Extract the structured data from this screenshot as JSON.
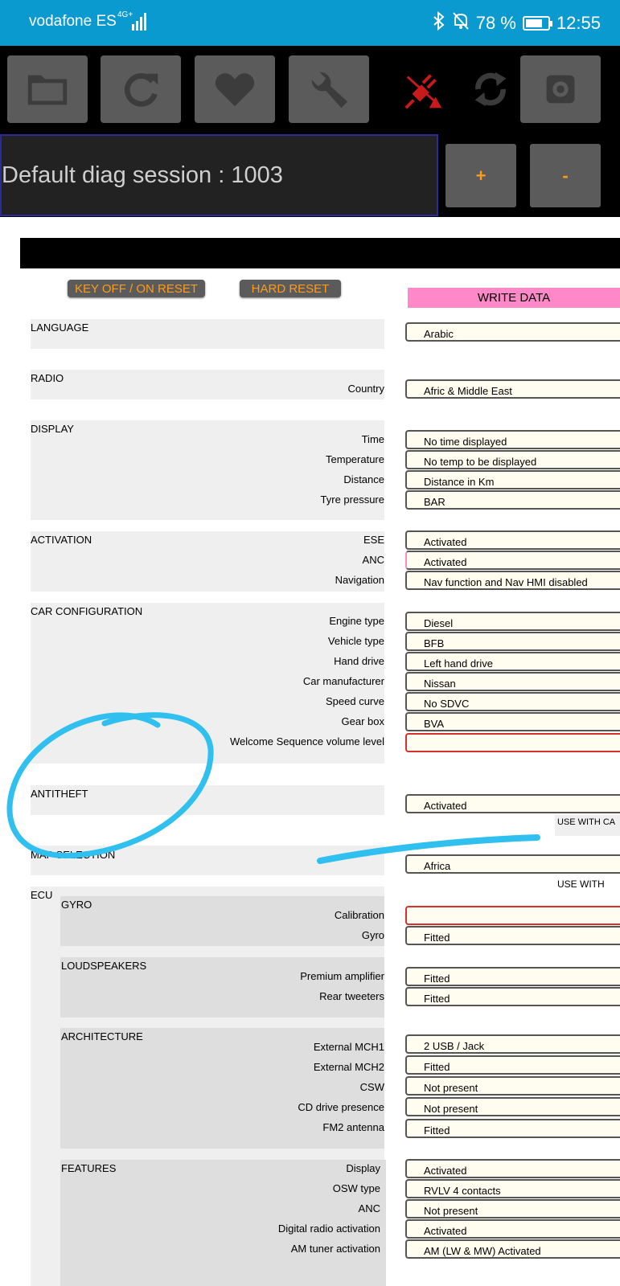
{
  "status_bar": {
    "carrier": "vodafone ES",
    "network": "4G+",
    "battery": "78 %",
    "battery_level": 0.78,
    "time": "12:55"
  },
  "toolbar": {
    "icons": [
      "folder-icon",
      "refresh-icon",
      "heart-icon",
      "wrench-icon",
      "disconnected-plug-icon",
      "sync-icon",
      "gear-icon"
    ],
    "session": "Default diag session : 1003",
    "plus_label": "+",
    "minus_label": "-"
  },
  "actions": {
    "key_reset": "KEY OFF / ON RESET",
    "hard_reset": "HARD RESET",
    "write_data": "WRITE DATA"
  },
  "sections": {
    "language": {
      "title": "LANGUAGE",
      "value": "Arabic"
    },
    "radio": {
      "title": "RADIO",
      "country_label": "Country",
      "country_value": "Afric & Middle East"
    },
    "display": {
      "title": "DISPLAY",
      "rows": [
        {
          "label": "Time",
          "value": "No time displayed"
        },
        {
          "label": "Temperature",
          "value": "No temp to be displayed"
        },
        {
          "label": "Distance",
          "value": "Distance in Km"
        },
        {
          "label": "Tyre pressure",
          "value": "BAR"
        }
      ]
    },
    "activation": {
      "title": "ACTIVATION",
      "rows": [
        {
          "label": "ESE",
          "value": "Activated"
        },
        {
          "label": "ANC",
          "value": "Activated"
        },
        {
          "label": "Navigation",
          "value": "Nav function and Nav HMI disabled"
        }
      ]
    },
    "car_configuration": {
      "title": "CAR CONFIGURATION",
      "rows": [
        {
          "label": "Engine type",
          "value": "Diesel"
        },
        {
          "label": "Vehicle type",
          "value": "BFB"
        },
        {
          "label": "Hand drive",
          "value": "Left hand drive"
        },
        {
          "label": "Car manufacturer",
          "value": "Nissan"
        },
        {
          "label": "Speed curve",
          "value": "No SDVC"
        },
        {
          "label": "Gear box",
          "value": "BVA"
        },
        {
          "label": "Welcome Sequence volume level",
          "value": ""
        }
      ]
    },
    "antitheft": {
      "title": "ANTITHEFT",
      "value": "Activated",
      "note": "USE WITH CA"
    },
    "map_selection": {
      "title": "MAP SELECTION",
      "value": "Africa",
      "note": "USE WITH"
    },
    "ecu": {
      "title": "ECU",
      "gyro": {
        "title": "GYRO",
        "rows": [
          {
            "label": "Calibration",
            "value": ""
          },
          {
            "label": "Gyro",
            "value": "Fitted"
          }
        ]
      },
      "loudspeakers": {
        "title": "LOUDSPEAKERS",
        "rows": [
          {
            "label": "Premium amplifier",
            "value": "Fitted"
          },
          {
            "label": "Rear tweeters",
            "value": "Fitted"
          }
        ]
      },
      "architecture": {
        "title": "ARCHITECTURE",
        "rows": [
          {
            "label": "External MCH1",
            "value": "2 USB / Jack"
          },
          {
            "label": "External MCH2",
            "value": "Fitted"
          },
          {
            "label": "CSW",
            "value": "Not present"
          },
          {
            "label": "CD drive presence",
            "value": "Not present"
          },
          {
            "label": "FM2 antenna",
            "value": "Fitted"
          }
        ]
      },
      "features": {
        "title": "FEATURES",
        "rows": [
          {
            "label": "Display",
            "value": "Activated"
          },
          {
            "label": "OSW type",
            "value": "RVLV 4 contacts"
          },
          {
            "label": "ANC",
            "value": "Not present"
          },
          {
            "label": "Digital radio activation",
            "value": "Activated"
          },
          {
            "label": "AM tuner activation",
            "value": "AM (LW & MW) Activated"
          }
        ]
      }
    }
  }
}
